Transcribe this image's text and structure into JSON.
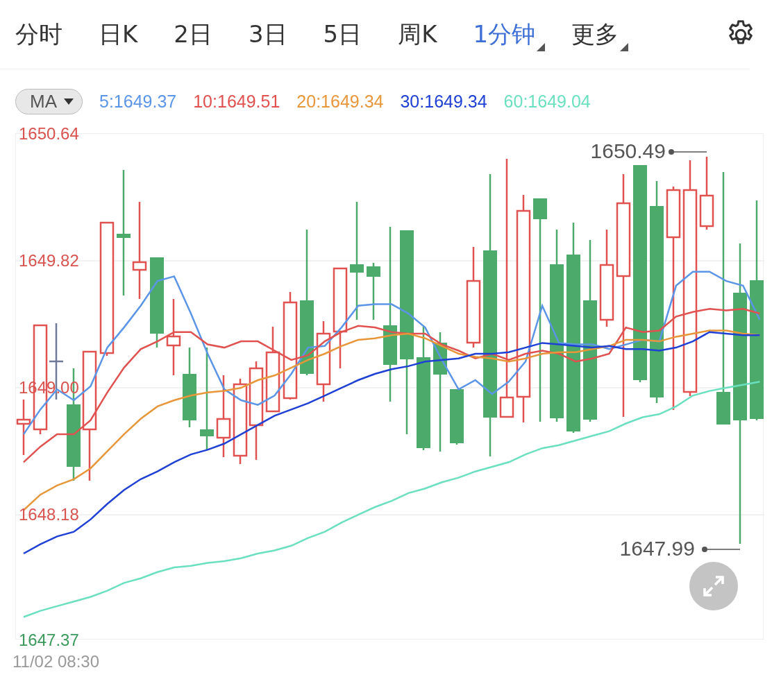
{
  "tabs": [
    {
      "label": "分时",
      "selected": false,
      "dropdown": false
    },
    {
      "label": "日K",
      "selected": false,
      "dropdown": false
    },
    {
      "label": "2日",
      "selected": false,
      "dropdown": false
    },
    {
      "label": "3日",
      "selected": false,
      "dropdown": false
    },
    {
      "label": "5日",
      "selected": false,
      "dropdown": false
    },
    {
      "label": "周K",
      "selected": false,
      "dropdown": false
    },
    {
      "label": "1分钟",
      "selected": true,
      "dropdown": true
    },
    {
      "label": "更多",
      "selected": false,
      "dropdown": true
    }
  ],
  "indicator": {
    "label": "MA"
  },
  "ma_values": [
    {
      "label": "5:1649.37",
      "color": "#5b95e8"
    },
    {
      "label": "10:1649.51",
      "color": "#e0514f"
    },
    {
      "label": "20:1649.34",
      "color": "#e8963a"
    },
    {
      "label": "30:1649.34",
      "color": "#1e40d4"
    },
    {
      "label": "60:1649.04",
      "color": "#6be0c0"
    }
  ],
  "chart": {
    "y_label_colors": [
      {
        "color": "#d9534f"
      },
      {
        "color": "#d9534f"
      },
      {
        "color": "#d9534f"
      },
      {
        "color": "#d9534f"
      },
      {
        "color": "#3a9a5b"
      }
    ],
    "high": "1650.49",
    "low": "1647.99",
    "chart_data": {
      "type": "line",
      "grid": true,
      "ylim": [
        1647.37,
        1650.64
      ],
      "yticks": [
        {
          "value": 1650.64,
          "label": "1650.64"
        },
        {
          "value": 1649.82,
          "label": "1649.82"
        },
        {
          "value": 1649,
          "label": "1649.00"
        },
        {
          "value": 1648.18,
          "label": "1648.18"
        },
        {
          "value": 1647.37,
          "label": "1647.37"
        }
      ],
      "series": [
        {
          "color": "#5b95e8",
          "values": [
            1648.7,
            1648.86,
            1648.99,
            1648.92,
            1649.01,
            1649.26,
            1649.39,
            1649.53,
            1649.69,
            1649.72,
            1649.48,
            1649.22,
            1648.99,
            1648.92,
            1648.89,
            1648.95,
            1649.09,
            1649.26,
            1649.27,
            1649.39,
            1649.53,
            1649.54,
            1649.54,
            1649.48,
            1649.39,
            1649.18,
            1648.99,
            1649.05,
            1648.96,
            1649.04,
            1649.17,
            1649.53,
            1649.29,
            1649.28,
            1649.28,
            1649.25,
            1649.28,
            1649.31,
            1649.3,
            1649.66,
            1649.75,
            1649.75,
            1649.69,
            1649.66,
            1649.44
          ]
        },
        {
          "color": "#e0514f",
          "values": [
            1648.52,
            1648.62,
            1648.7,
            1648.7,
            1648.79,
            1648.97,
            1649.13,
            1649.25,
            1649.3,
            1649.36,
            1649.36,
            1649.28,
            1649.26,
            1649.3,
            1649.3,
            1649.24,
            1649.18,
            1649.21,
            1649.3,
            1649.36,
            1649.4,
            1649.39,
            1649.36,
            1649.35,
            1649.35,
            1649.28,
            1649.24,
            1649.19,
            1649.22,
            1649.18,
            1649.22,
            1649.24,
            1649.22,
            1649.17,
            1649.19,
            1649.22,
            1649.39,
            1649.36,
            1649.37,
            1649.46,
            1649.49,
            1649.51,
            1649.5,
            1649.51,
            1649.48
          ]
        },
        {
          "color": "#e8963a",
          "values": [
            1648.21,
            1648.31,
            1648.37,
            1648.41,
            1648.48,
            1648.59,
            1648.7,
            1648.8,
            1648.88,
            1648.92,
            1648.95,
            1648.97,
            1648.98,
            1649.0,
            1649.05,
            1649.08,
            1649.13,
            1649.18,
            1649.22,
            1649.27,
            1649.31,
            1649.32,
            1649.34,
            1649.35,
            1649.32,
            1649.27,
            1649.22,
            1649.2,
            1649.19,
            1649.17,
            1649.19,
            1649.22,
            1649.23,
            1649.23,
            1649.25,
            1649.27,
            1649.31,
            1649.31,
            1649.3,
            1649.33,
            1649.35,
            1649.37,
            1649.37,
            1649.35,
            1649.34
          ]
        },
        {
          "color": "#1e40d4",
          "values": [
            1647.93,
            1647.99,
            1648.04,
            1648.07,
            1648.15,
            1648.25,
            1648.34,
            1648.41,
            1648.46,
            1648.52,
            1648.57,
            1648.6,
            1648.64,
            1648.7,
            1648.76,
            1648.82,
            1648.86,
            1648.9,
            1648.95,
            1649.0,
            1649.05,
            1649.09,
            1649.12,
            1649.14,
            1649.17,
            1649.18,
            1649.19,
            1649.22,
            1649.22,
            1649.23,
            1649.26,
            1649.29,
            1649.28,
            1649.27,
            1649.26,
            1649.27,
            1649.25,
            1649.25,
            1649.24,
            1649.26,
            1649.3,
            1649.36,
            1649.35,
            1649.34,
            1649.34
          ]
        },
        {
          "color": "#6be0c0",
          "values": [
            1647.52,
            1647.56,
            1647.59,
            1647.62,
            1647.65,
            1647.69,
            1647.74,
            1647.77,
            1647.81,
            1647.84,
            1647.85,
            1647.87,
            1647.88,
            1647.9,
            1647.93,
            1647.95,
            1647.98,
            1648.03,
            1648.07,
            1648.13,
            1648.18,
            1648.23,
            1648.27,
            1648.32,
            1648.35,
            1648.39,
            1648.42,
            1648.46,
            1648.49,
            1648.52,
            1648.57,
            1648.61,
            1648.63,
            1648.66,
            1648.69,
            1648.72,
            1648.77,
            1648.81,
            1648.83,
            1648.88,
            1648.95,
            1648.98,
            1649.0,
            1649.02,
            1649.04
          ]
        }
      ]
    }
  },
  "time_label": "11/02 08:30"
}
